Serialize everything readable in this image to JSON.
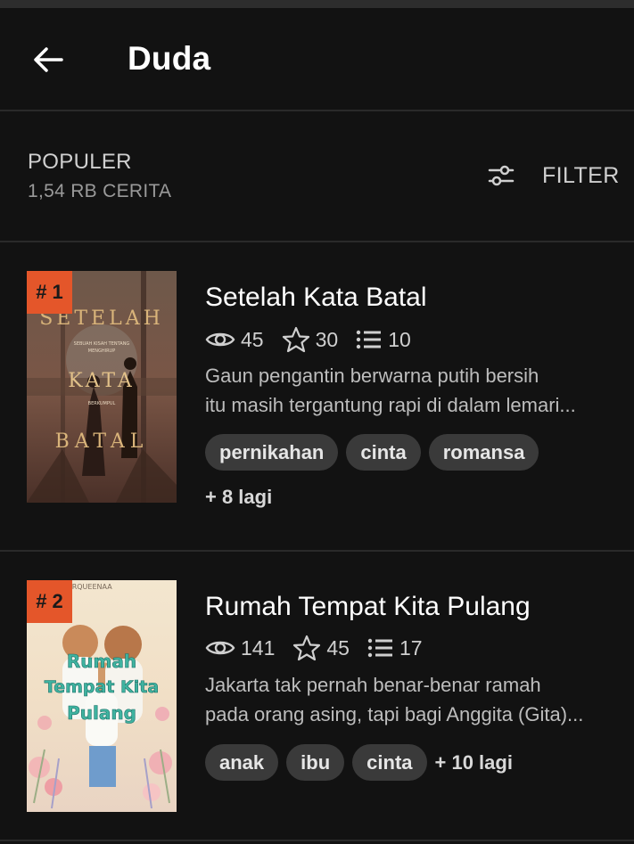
{
  "header": {
    "title": "Duda"
  },
  "list": {
    "sort_label": "POPULER",
    "count": "1,54 RB CERITA",
    "filter_label": "FILTER"
  },
  "stories": [
    {
      "rank": "# 1",
      "title": "Setelah Kata Batal",
      "views": "45",
      "votes": "30",
      "parts": "10",
      "desc1": "Gaun pengantin berwarna putih bersih",
      "desc2": "itu masih tergantung rapi di dalam lemari...",
      "tags": [
        "pernikahan",
        "cinta",
        "romansa"
      ],
      "more": "+ 8 lagi",
      "cover": {
        "line1": "SETELAH",
        "line2": "KATA",
        "line3": "BATAL",
        "tiny1": "SEBUAH KISAH TENTANG",
        "tiny2": "MENGHIRUP",
        "tiny3": "BERKUMPUL"
      }
    },
    {
      "rank": "# 2",
      "title": "Rumah Tempat Kita Pulang",
      "views": "141",
      "votes": "45",
      "parts": "17",
      "desc1": "Jakarta tak pernah benar-benar ramah",
      "desc2": "pada orang asing, tapi bagi Anggita (Gita)...",
      "tags": [
        "anak",
        "ibu",
        "cinta"
      ],
      "more": "+ 10 lagi",
      "cover": {
        "author": "DEARQUEENAA",
        "line1": "Rumah",
        "line2": "Tempat Kita",
        "line3": "Pulang"
      }
    }
  ]
}
